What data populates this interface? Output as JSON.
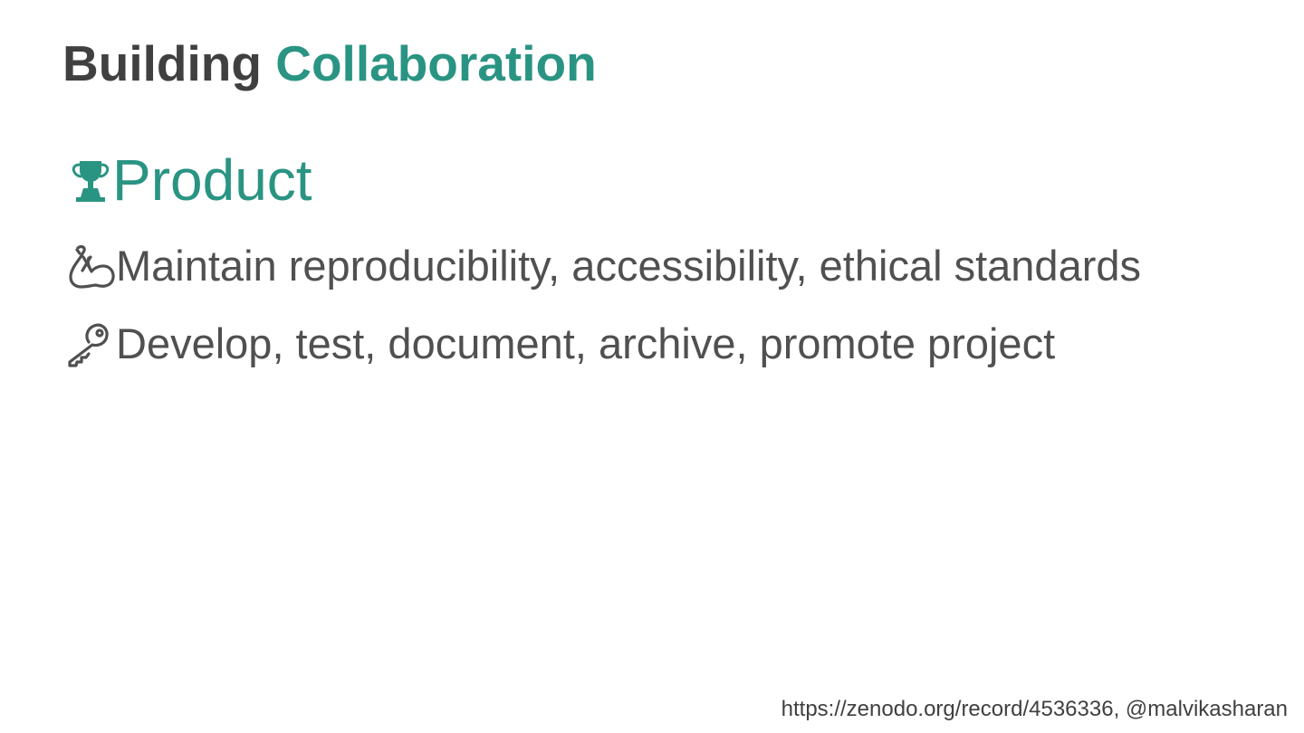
{
  "slide": {
    "title_part1": "Building",
    "title_part2": "Collaboration",
    "section": {
      "label": "Product",
      "icon": "trophy-icon"
    },
    "bullets": [
      {
        "icon": "arm-flex-icon",
        "text": "Maintain reproducibility, accessibility, ethical standards"
      },
      {
        "icon": "key-icon",
        "text": "Develop, test, document, archive, promote project"
      }
    ],
    "footer": "https://zenodo.org/record/4536336, @malvikasharan"
  },
  "colors": {
    "accent": "#2a9483",
    "title_dark": "#404040",
    "body_text": "#505050"
  }
}
